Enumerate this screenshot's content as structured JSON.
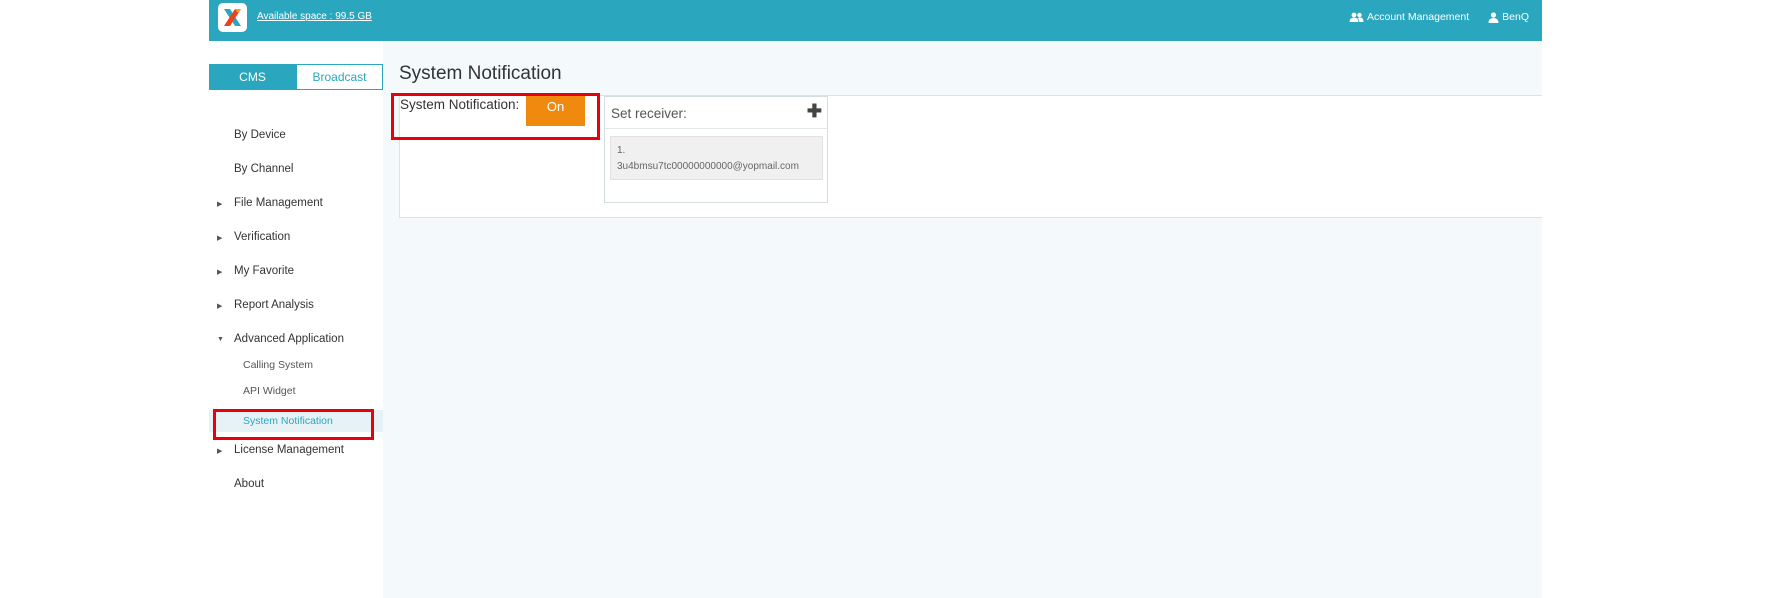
{
  "header": {
    "available_space": "Available space : 99.5 GB",
    "account_management": "Account Management",
    "user": "BenQ",
    "icons": {
      "logo": "app-logo",
      "account": "users-icon",
      "user": "user-icon"
    }
  },
  "sidebar": {
    "tabs": [
      {
        "label": "CMS",
        "active": true
      },
      {
        "label": "Broadcast",
        "active": false
      }
    ],
    "items": [
      {
        "label": "By Device",
        "expandable": false
      },
      {
        "label": "By Channel",
        "expandable": false
      },
      {
        "label": "File Management",
        "expandable": true
      },
      {
        "label": "Verification",
        "expandable": true
      },
      {
        "label": "My Favorite",
        "expandable": true
      },
      {
        "label": "Report Analysis",
        "expandable": true
      },
      {
        "label": "Advanced Application",
        "expandable": true,
        "expanded": true
      },
      {
        "label": "License Management",
        "expandable": true
      },
      {
        "label": "About",
        "expandable": false
      }
    ],
    "sub_items": [
      {
        "label": "Calling System",
        "active": false
      },
      {
        "label": "API Widget",
        "active": false
      },
      {
        "label": "System Notification",
        "active": true
      }
    ]
  },
  "main": {
    "title": "System Notification",
    "notification_label": "System Notification:",
    "toggle_label": "On",
    "receiver": {
      "title": "Set receiver:",
      "add_icon": "plus-icon",
      "entries": [
        {
          "index": "1.",
          "email": "3u4bmsu7tc00000000000@yopmail.com"
        }
      ]
    }
  },
  "colors": {
    "brand": "#2aa7bf",
    "toggle_on": "#ef8a0f",
    "highlight": "#e8000b"
  }
}
